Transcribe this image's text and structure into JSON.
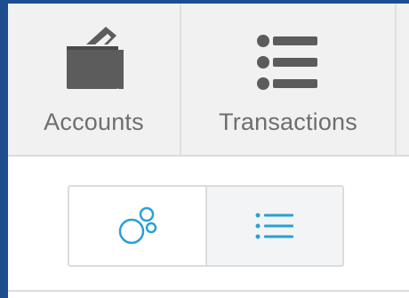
{
  "tabs": [
    {
      "label": "Accounts",
      "icon": "wallet-icon",
      "selected": false
    },
    {
      "label": "Transactions",
      "icon": "list-icon",
      "selected": false
    }
  ],
  "view_toggle": {
    "options": [
      {
        "icon": "bubbles-icon",
        "selected": false
      },
      {
        "icon": "list-icon",
        "selected": true
      }
    ]
  },
  "colors": {
    "frame_border": "#1d4e8f",
    "tab_background": "#f1f1f1",
    "tab_icon": "#5c5c5c",
    "tab_label": "#6e6e6e",
    "toggle_accent": "#2aa0d4",
    "toggle_selected_background": "#f3f4f6"
  }
}
